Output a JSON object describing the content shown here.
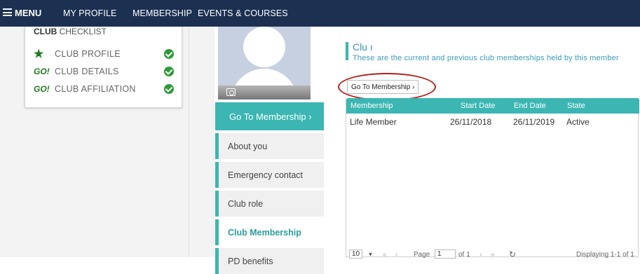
{
  "topnav": {
    "menu_label": "MENU",
    "items": [
      "MY PROFILE",
      "MEMBERSHIP",
      "EVENTS & COURSES"
    ]
  },
  "checklist": {
    "title_bold": "CLUB",
    "title_rest": " CHECKLIST",
    "items": [
      {
        "icon": "star-icon",
        "icon_text": "★",
        "label": "CLUB PROFILE"
      },
      {
        "icon": "go-icon",
        "icon_text": "GO!",
        "label": "CLUB DETAILS"
      },
      {
        "icon": "go-icon",
        "icon_text": "GO!",
        "label": "CLUB AFFILIATION"
      }
    ]
  },
  "sidemenu": {
    "primary": "Go To Membership ›",
    "items": [
      "About you",
      "Emergency contact",
      "Club role",
      "Club Membership",
      "PD benefits"
    ]
  },
  "main": {
    "heading": "Clu                    ı",
    "subheading": "These are the current and previous club memberships held by this member",
    "goto_button": "Go To Membership ›"
  },
  "grid": {
    "columns": [
      "Membership",
      "Start Date",
      "End Date",
      "State"
    ],
    "rows": [
      [
        "Life Member",
        "26/11/2018",
        "26/11/2019",
        "Active"
      ]
    ]
  },
  "pager": {
    "page_size": "10",
    "page_label": "Page",
    "page_value": "1",
    "of_label": "of 1",
    "displaying": "Displaying 1-1 of 1"
  },
  "colors": {
    "nav_bg": "#1c3052",
    "accent_teal": "#3bb6b3",
    "check_green": "#2e9a3a",
    "annotation_red": "#b31e1e"
  }
}
